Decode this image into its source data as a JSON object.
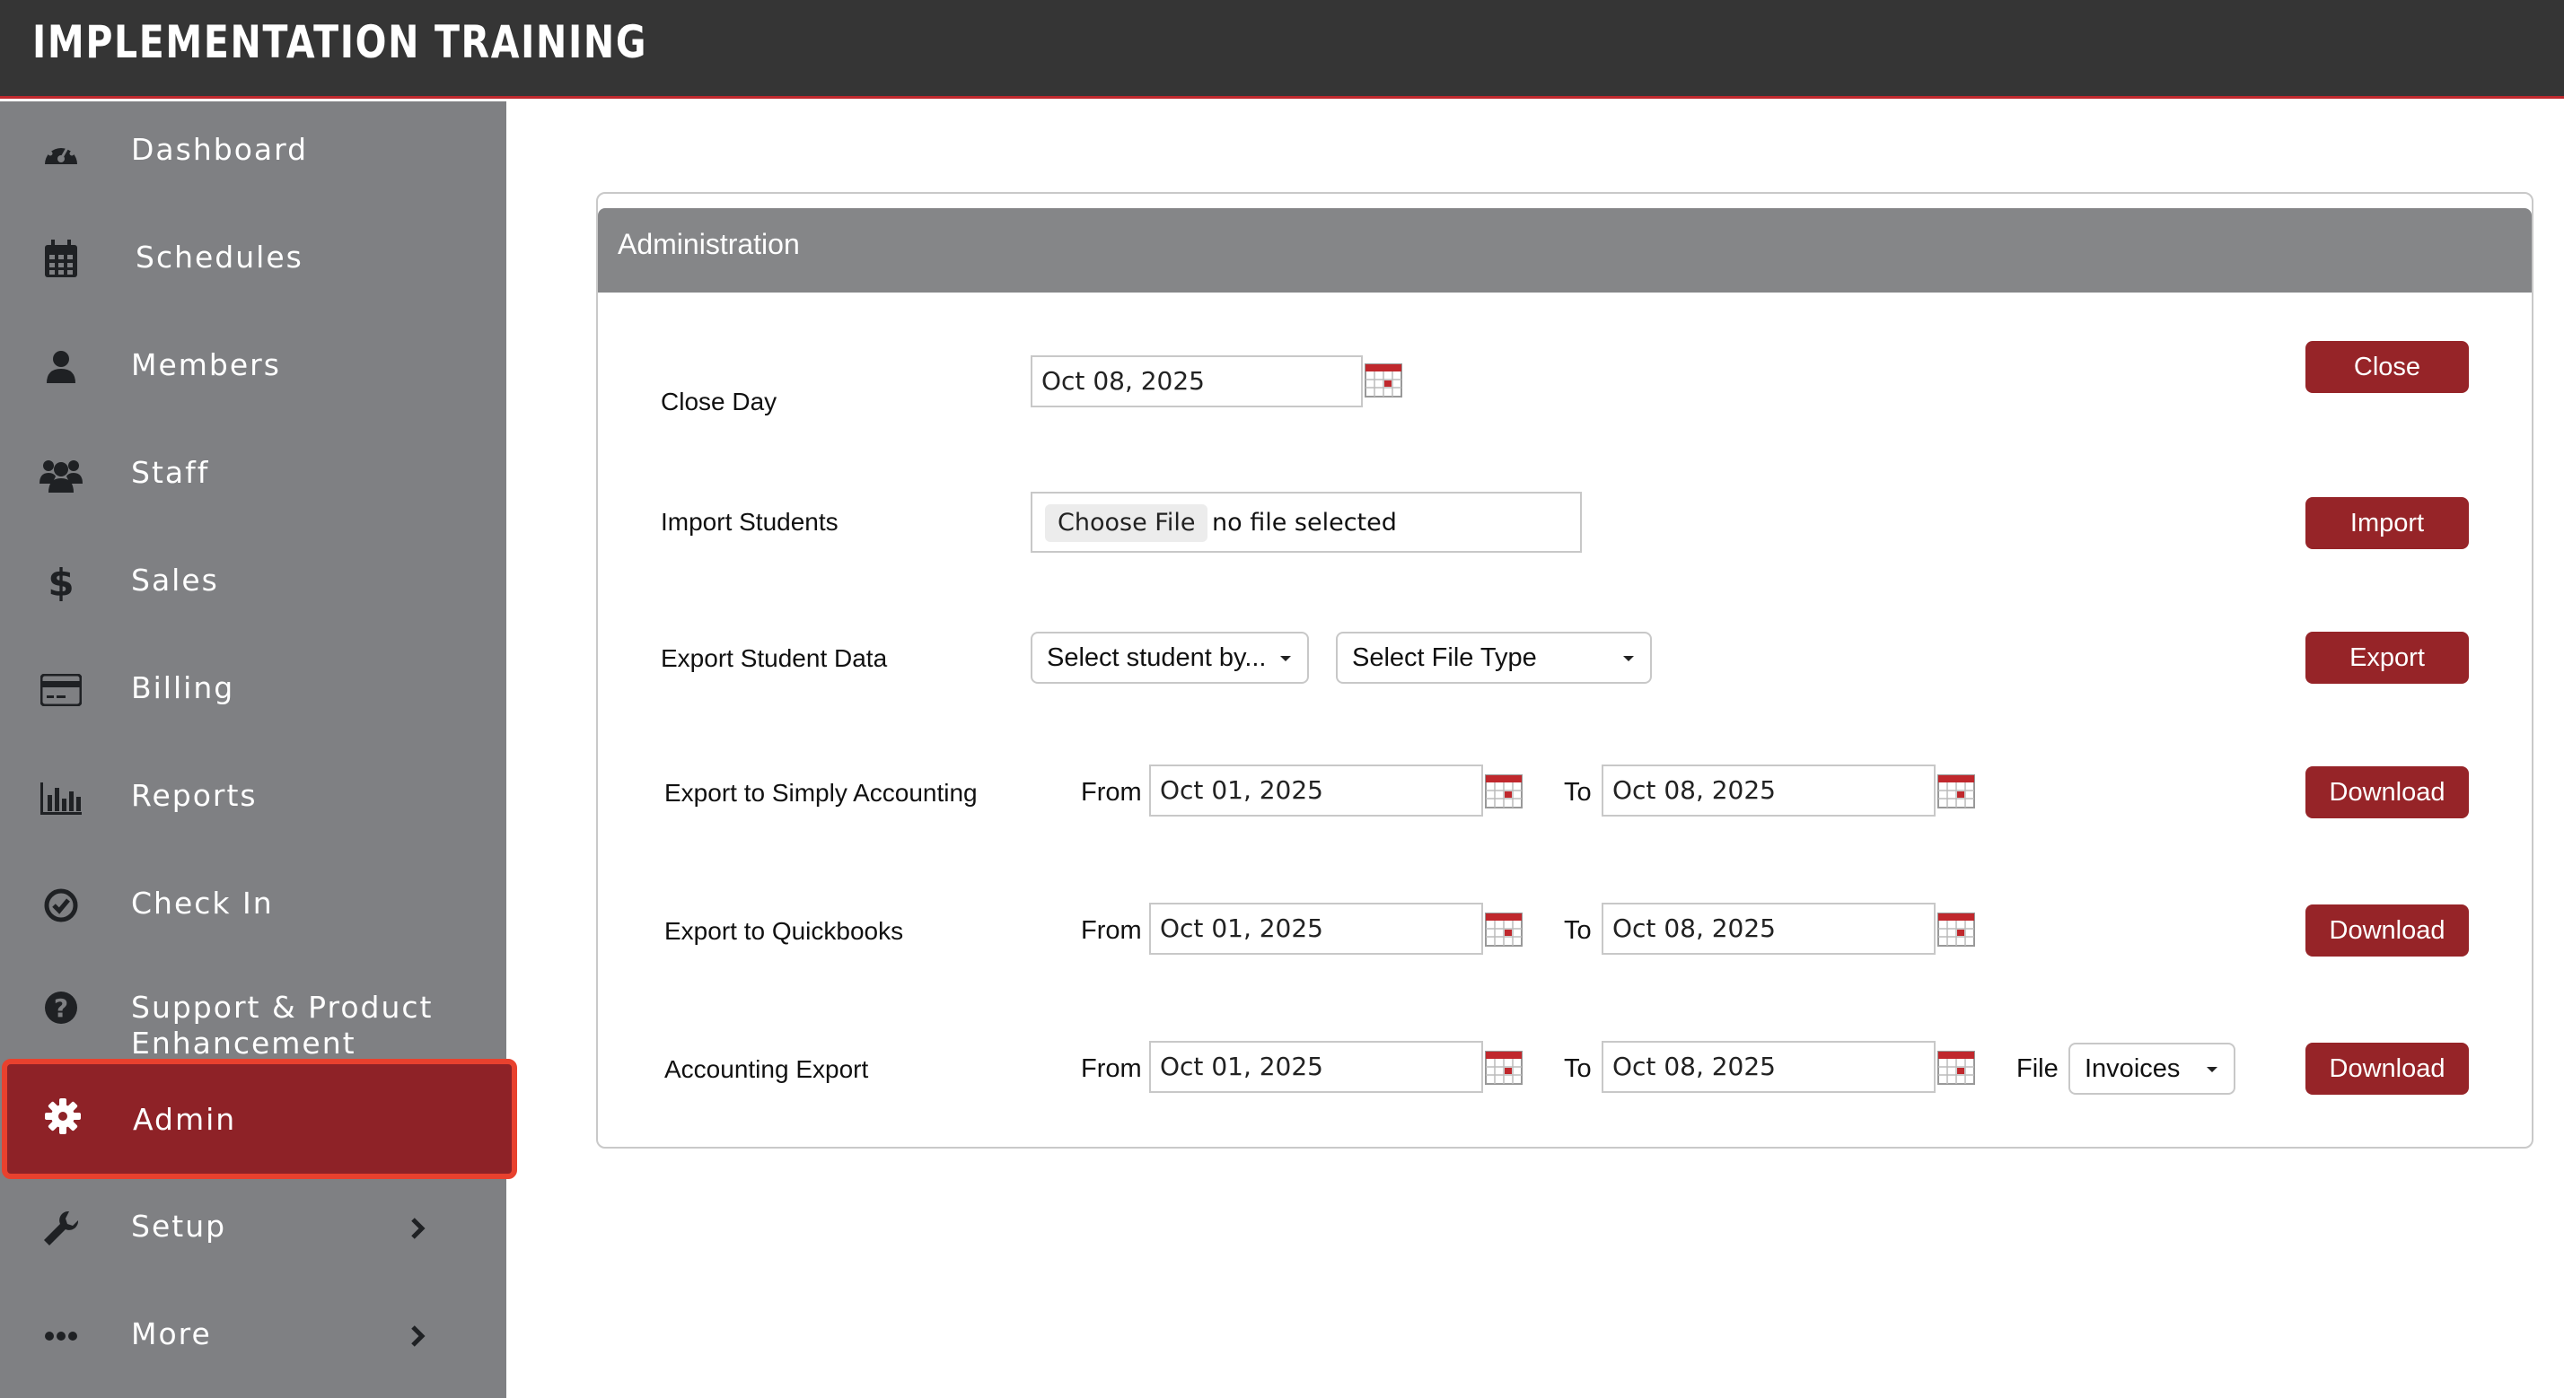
{
  "app": {
    "title": "IMPLEMENTATION TRAINING"
  },
  "colors": {
    "topbar": "#353535",
    "sidebar": "#7f8083",
    "active": "#8e2227",
    "highlight": "#e8412e",
    "button": "#962428",
    "card_header": "#858688"
  },
  "sidebar": {
    "items": [
      {
        "label": "Dashboard",
        "icon": "dashboard-icon"
      },
      {
        "label": "Schedules",
        "icon": "calendar-icon"
      },
      {
        "label": "Members",
        "icon": "user-icon"
      },
      {
        "label": "Staff",
        "icon": "users-icon"
      },
      {
        "label": "Sales",
        "icon": "dollar-icon"
      },
      {
        "label": "Billing",
        "icon": "credit-card-icon"
      },
      {
        "label": "Reports",
        "icon": "bar-chart-icon"
      },
      {
        "label": "Check In",
        "icon": "check-circle-icon"
      },
      {
        "label_line1": "Support & Product",
        "label_line2": "Enhancement",
        "icon": "question-circle-icon"
      },
      {
        "label": "Admin",
        "icon": "gear-icon",
        "active": true
      },
      {
        "label": "Setup",
        "icon": "wrench-icon"
      },
      {
        "label": "More",
        "icon": "ellipsis-icon"
      }
    ]
  },
  "card": {
    "title": "Administration",
    "close_day": {
      "label": "Close  Day",
      "date": "Oct 08, 2025",
      "button": "Close"
    },
    "import_students": {
      "label": "Import Students",
      "choose": "Choose File",
      "status": "no file selected",
      "button": "Import"
    },
    "export_student_data": {
      "label": "Export Student Data",
      "select_by": "Select student by...",
      "file_type": "Select File Type",
      "button": "Export"
    },
    "simply_accounting": {
      "label": "Export to Simply Accounting",
      "from_label": "From",
      "from": "Oct 01, 2025",
      "to_label": "To",
      "to": "Oct 08, 2025",
      "button": "Download"
    },
    "quickbooks": {
      "label": "Export to Quickbooks",
      "from_label": "From",
      "from": "Oct 01, 2025",
      "to_label": "To",
      "to": "Oct 08, 2025",
      "button": "Download"
    },
    "accounting_export": {
      "label": "Accounting Export",
      "from_label": "From",
      "from": "Oct 01, 2025",
      "to_label": "To",
      "to": "Oct 08, 2025",
      "file_label": "File",
      "file_value": "Invoices",
      "button": "Download"
    }
  }
}
